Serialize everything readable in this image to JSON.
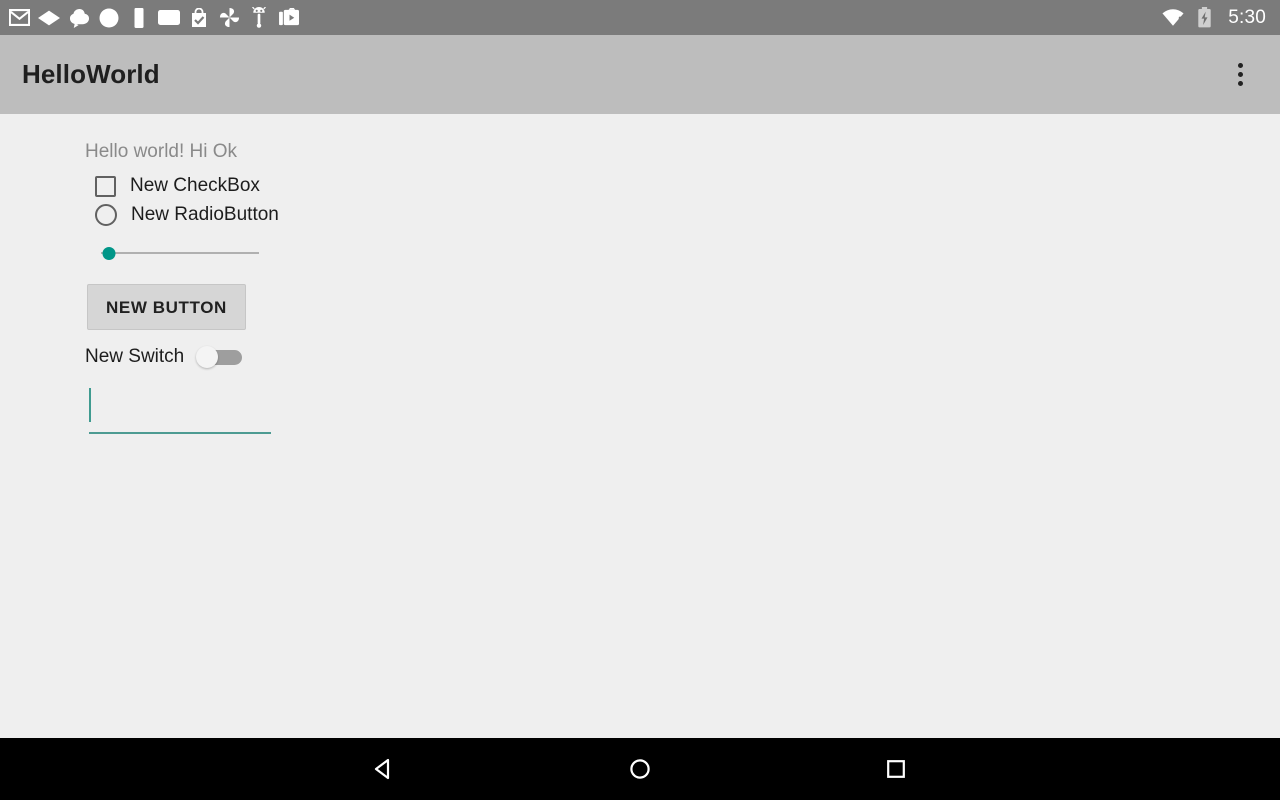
{
  "status_bar": {
    "background": "#7b7b7b",
    "time": "5:30",
    "notification_icons": [
      {
        "name": "gmail-icon"
      },
      {
        "name": "drive-icon"
      },
      {
        "name": "keep-icon"
      },
      {
        "name": "circle-app-icon"
      },
      {
        "name": "vertical-bar-icon"
      },
      {
        "name": "rounded-rect-icon"
      },
      {
        "name": "play-store-checked-icon"
      },
      {
        "name": "photos-pinwheel-icon"
      },
      {
        "name": "android-robot-icon"
      },
      {
        "name": "media-gallery-icon"
      }
    ],
    "signal_icons": [
      {
        "name": "wifi-warning-icon"
      },
      {
        "name": "battery-charging-icon"
      }
    ]
  },
  "app_bar": {
    "title": "HelloWorld",
    "background": "#bdbdbd",
    "overflow_label": "More options"
  },
  "content": {
    "hello_text": "Hello world! Hi Ok",
    "checkbox": {
      "label": "New CheckBox",
      "checked": false
    },
    "radio": {
      "label": "New RadioButton",
      "selected": false
    },
    "seekbar": {
      "value": 0,
      "min": 0,
      "max": 100,
      "accent_color": "#009688"
    },
    "button": {
      "label": "NEW BUTTON"
    },
    "switch": {
      "label": "New Switch",
      "checked": false
    },
    "edit_text": {
      "value": "",
      "placeholder": "",
      "focused": true,
      "accent_color": "#4d9b92"
    }
  },
  "nav_bar": {
    "background": "#000000",
    "back_label": "Back",
    "home_label": "Home",
    "recents_label": "Recent apps"
  }
}
